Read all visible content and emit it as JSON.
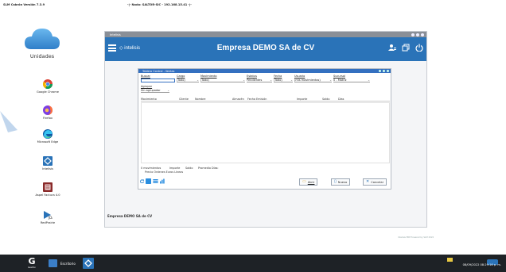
{
  "topbar": {
    "version": "SLM Cabrón Versión 7.3.9",
    "node": "-|- Nodo: SALTOR-SIC - 192.168.15.41 -|-"
  },
  "desktop": {
    "main_icon_label": "Unidades",
    "icons": [
      {
        "label": "Google Chrome",
        "icon": "chrome-icon"
      },
      {
        "label": "Firefox",
        "icon": "firefox-icon"
      },
      {
        "label": "Microsoft Edge",
        "icon": "edge-icon"
      },
      {
        "label": "Intelisis",
        "icon": "intelisis-icon"
      },
      {
        "label": "Aspel Factura 4.0",
        "icon": "aspel-icon"
      },
      {
        "label": "RedPrairie",
        "icon": "redprairie-icon"
      }
    ]
  },
  "app": {
    "window_title": "Intelisis",
    "brand": "intelisis",
    "company": "Empresa DEMO SA de CV",
    "status_company": "Empresa DEMO SA de CV",
    "header_icons": [
      "user-icon",
      "window-icon",
      "power-icon"
    ]
  },
  "dialog": {
    "title": "Tablero Control - Ventas",
    "filters": {
      "buscar_label": "Buscar",
      "cargo_label": "Cargo",
      "cargo_value": "(Todo)",
      "movimiento_label": "Movimiento",
      "movimiento_value": "(Todo)",
      "estatus_label": "Estatus",
      "estatus_value": "Pendientes",
      "fecha_label": "Fecha",
      "fecha_value": "(Todo)",
      "usuario_label": "Usuario",
      "usuario_value": "(mis movimientos)",
      "sucursal_label": "Sucursal",
      "sucursal_value": "0 - Matriz",
      "agrupar_label": "Agrupar",
      "agrupar_value": "Sin agrupador"
    },
    "columns": [
      "Movimiento",
      "Cliente",
      "Nombre",
      "Almacén",
      "Fecha Emisión",
      "Importe",
      "Saldo",
      "Días"
    ],
    "footer": {
      "movimientos": "0 movimientos",
      "importe": "Importe",
      "saldo": "Saldo",
      "promedio": "Promedio Días:",
      "sub": "Precio  Órdenes  Euros  Líneas"
    },
    "buttons": {
      "abrir": "Abrir",
      "nuevo": "Nuevo",
      "cancelar": "Cancelar"
    }
  },
  "watermark": "Intelisis ERP Powered by SLM 2022",
  "taskbar": {
    "start_sub": "Gestión",
    "escritorio": "Escritorio",
    "clock": "08/09/2022 08:29:16 p. m."
  },
  "colors": {
    "header_blue": "#2a73b8",
    "dialog_blue": "#3470c0",
    "taskbar": "#1e2226"
  }
}
